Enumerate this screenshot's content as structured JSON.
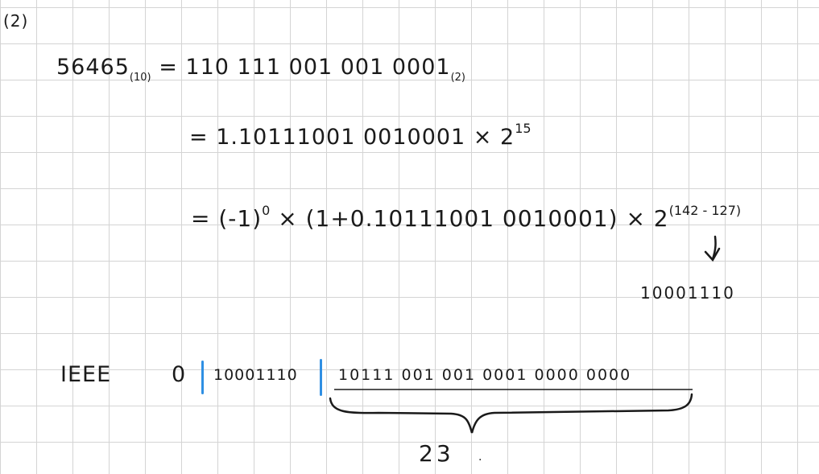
{
  "question_label": "(2)",
  "line1": {
    "lhs": "56465",
    "lhs_base": "(10)",
    "eq": "=",
    "rhs": "110 111 001 001 0001",
    "rhs_base": "(2)"
  },
  "line2": {
    "text": "= 1.10111001 0010001 × 2",
    "power": "15"
  },
  "line3": {
    "text": "= (-1)",
    "sign_power": "0",
    "text2": " × (1+0.10111001 0010001) × 2",
    "power": "(142 - 127)"
  },
  "exponent_binary": "10001110",
  "ieee": {
    "label": "IEEE",
    "sign_bit": "0",
    "exponent_bits": "10001110",
    "mantissa_bits": "10111 001 001 0001 0000 0000",
    "mantissa_length": "23"
  },
  "colors": {
    "ink": "#1a1a1a",
    "field_separator": "#2f8fe3",
    "grid": "#d4d4d4"
  }
}
